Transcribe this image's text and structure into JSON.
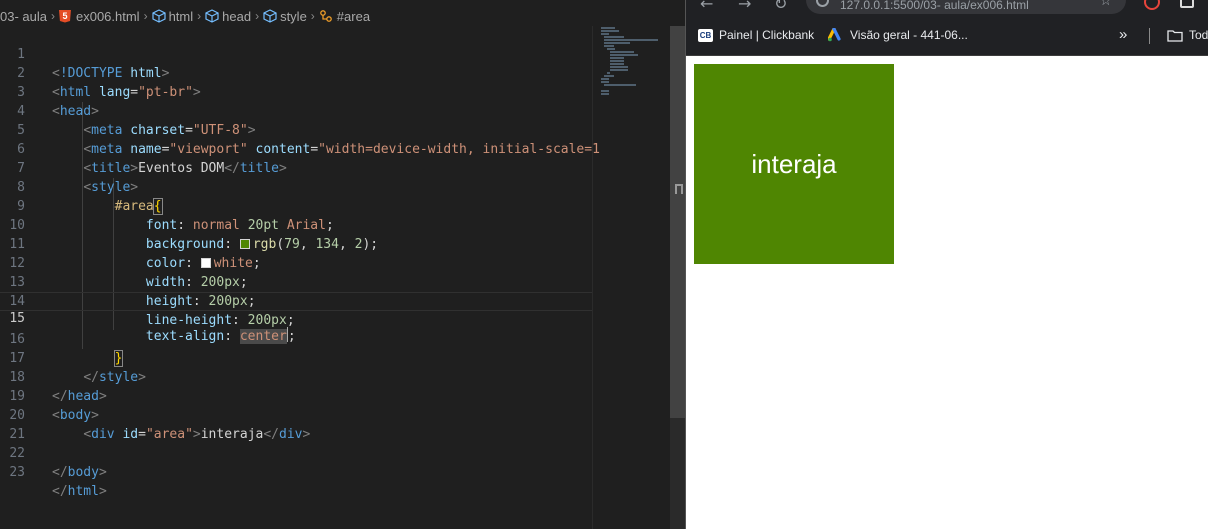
{
  "breadcrumb": {
    "folder": "03- aula",
    "file": "ex006.html",
    "items": [
      "html",
      "head",
      "style",
      "#area"
    ]
  },
  "editor": {
    "current_line": 15,
    "line_numbers": [
      "1",
      "2",
      "3",
      "4",
      "5",
      "6",
      "7",
      "8",
      "9",
      "10",
      "11",
      "12",
      "13",
      "14",
      "15",
      "16",
      "17",
      "18",
      "19",
      "20",
      "21",
      "22",
      "23"
    ],
    "lines": [
      "<!DOCTYPE html>",
      "<html lang=\"pt-br\">",
      "<head>",
      "    <meta charset=\"UTF-8\">",
      "    <meta name=\"viewport\" content=\"width=device-width, initial-scale=1",
      "    <title>Eventos DOM</title>",
      "    <style>",
      "        #area{",
      "            font: normal 20pt Arial;",
      "            background: rgb(79, 134, 2);",
      "            color: white;",
      "            width: 200px;",
      "            height: 200px;",
      "            line-height: 200px;",
      "            text-align: center;",
      "        }",
      "    </style>",
      "</head>",
      "<body>",
      "    <div id=\"area\">interaja</div>",
      "",
      "</body>",
      "</html>"
    ]
  },
  "browser": {
    "url": "127.0.0.1:5500/03- aula/ex006.html",
    "bookmarks": [
      "Painel | Clickbank",
      "Visão geral - 441-06...",
      "Tod"
    ],
    "page": {
      "area_text": "interaja",
      "area_color": "#4f8602",
      "text_color": "#ffffff"
    }
  },
  "colors": {
    "editor_bg": "#1f1f1f",
    "tag": "#569cd6",
    "attr": "#9cdcfe",
    "string": "#ce9178",
    "number": "#b5cea8",
    "selector": "#d7ba7d"
  }
}
